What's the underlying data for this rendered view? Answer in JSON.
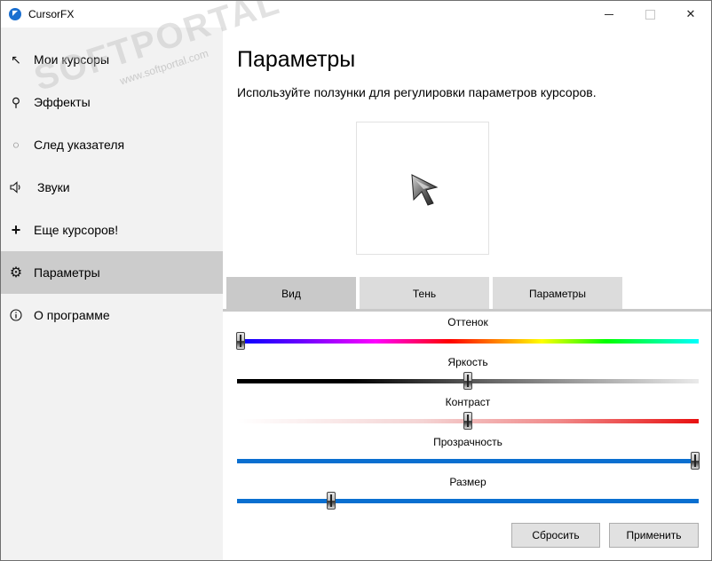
{
  "window": {
    "title": "CursorFX"
  },
  "sidebar": {
    "items": [
      {
        "label": "Мои курсоры",
        "icon": "arrow-pointer-icon"
      },
      {
        "label": "Эффекты",
        "icon": "magic-wand-icon"
      },
      {
        "label": "След указателя",
        "icon": "trail-icon"
      },
      {
        "label": "Звуки",
        "icon": "speaker-icon"
      },
      {
        "label": "Еще курсоров!",
        "icon": "plus-icon"
      },
      {
        "label": "Параметры",
        "icon": "gear-icon",
        "active": true
      },
      {
        "label": "О программе",
        "icon": "info-icon"
      }
    ]
  },
  "main": {
    "title": "Параметры",
    "subtitle": "Используйте ползунки для регулировки параметров курсоров."
  },
  "tabs": [
    {
      "label": "Вид",
      "active": true
    },
    {
      "label": "Тень",
      "active": false
    },
    {
      "label": "Параметры",
      "active": false
    }
  ],
  "sliders": [
    {
      "label": "Оттенок",
      "value": 0.0
    },
    {
      "label": "Яркость",
      "value": 0.5
    },
    {
      "label": "Контраст",
      "value": 0.5
    },
    {
      "label": "Прозрачность",
      "value": 1.0
    },
    {
      "label": "Размер",
      "value": 0.2
    }
  ],
  "buttons": {
    "reset": "Сбросить",
    "apply": "Применить"
  },
  "watermark": {
    "main": "SOFTPORTAL",
    "sub": "www.softportal.com"
  },
  "colors": {
    "sidebar_bg": "#f2f2f2",
    "active_item_bg": "#cccccc",
    "slider_blue": "#0a6fd0"
  }
}
